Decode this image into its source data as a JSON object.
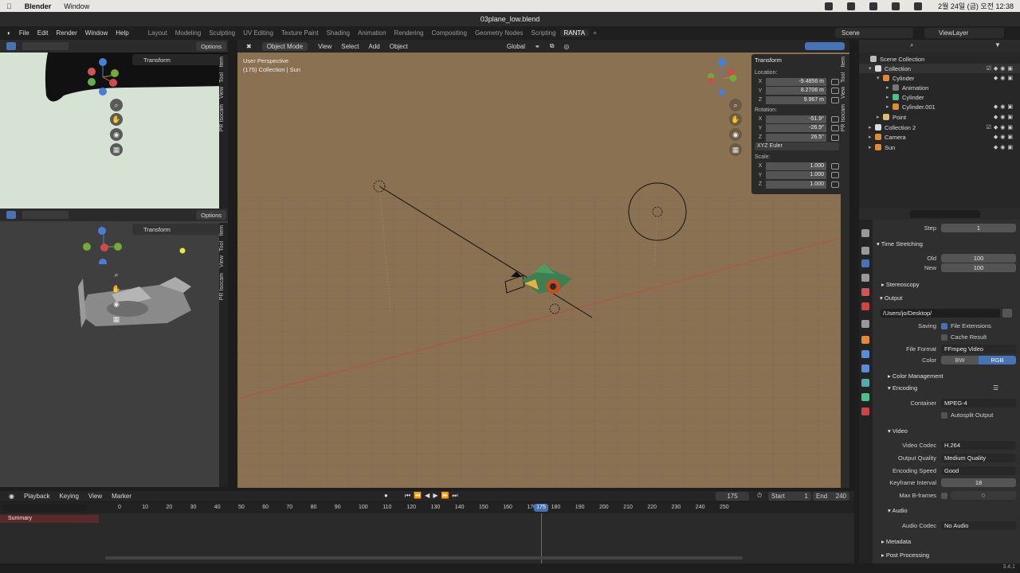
{
  "mac": {
    "app": "Blender",
    "menu": [
      "Window"
    ],
    "clock": "2월 24일 (금) 오전 12:38"
  },
  "window_title": "03plane_low.blend",
  "menus": [
    "File",
    "Edit",
    "Render",
    "Window",
    "Help"
  ],
  "workspaces": [
    "Layout",
    "Modeling",
    "Sculpting",
    "UV Editing",
    "Texture Paint",
    "Shading",
    "Animation",
    "Rendering",
    "Compositing",
    "Geometry Nodes",
    "Scripting",
    "RANTA",
    "+"
  ],
  "scene": "Scene",
  "view_layer": "ViewLayer",
  "left_top": {
    "options": "Options",
    "transform": "Transform",
    "tabs": [
      "Item",
      "Tool",
      "View",
      "PR Isocam"
    ]
  },
  "left_bottom": {
    "options": "Options",
    "transform": "Transform",
    "tabs": [
      "Item",
      "Tool",
      "View",
      "PR Isocam"
    ]
  },
  "viewport": {
    "mode": "Object Mode",
    "menus": [
      "View",
      "Select",
      "Add",
      "Object"
    ],
    "orientation": "Global",
    "info1": "User Perspective",
    "info2": "(175) Collection | Sun",
    "side_tabs": [
      "Item",
      "Tool",
      "View",
      "PR Isocam"
    ]
  },
  "npanel": {
    "title": "Transform",
    "location_label": "Location:",
    "location": {
      "x": "-9.4856 m",
      "y": "8.2706 m",
      "z": "9.967 m"
    },
    "rotation_label": "Rotation:",
    "rotation": {
      "x": "-51.9°",
      "y": "-26.9°",
      "z": "26.5°"
    },
    "euler": "XYZ Euler",
    "scale_label": "Scale:",
    "scale": {
      "x": "1.000",
      "y": "1.000",
      "z": "1.000"
    },
    "axes": [
      "X",
      "Y",
      "Z"
    ]
  },
  "outliner": {
    "items": [
      "Scene Collection",
      "Collection",
      "Cylinder",
      "Animation",
      "Cylinder",
      "Cylinder.001",
      "Point",
      "Collection 2",
      "Camera",
      "Sun"
    ]
  },
  "properties": {
    "step_label": "Step",
    "step": "1",
    "time_stretching": "Time Stretching",
    "old_label": "Old",
    "old": "100",
    "new_label": "New",
    "new": "100",
    "stereoscopy": "Stereoscopy",
    "output": "Output",
    "path": "/Users/jo/Desktop/",
    "saving_label": "Saving",
    "file_extensions": "File Extensions",
    "cache_result": "Cache Result",
    "file_format_label": "File Format",
    "file_format": "FFmpeg Video",
    "color_label": "Color",
    "color_bw": "BW",
    "color_rgb": "RGB",
    "color_management": "Color Management",
    "encoding": "Encoding",
    "container_label": "Container",
    "container": "MPEG-4",
    "autosplit": "Autosplit Output",
    "video": "Video",
    "codec_label": "Video Codec",
    "codec": "H.264",
    "quality_label": "Output Quality",
    "quality": "Medium Quality",
    "speed_label": "Encoding Speed",
    "speed": "Good",
    "keyframe_label": "Keyframe Interval",
    "keyframe": "18",
    "bframes_label": "Max B-frames",
    "bframes": "0",
    "audio": "Audio",
    "audio_codec_label": "Audio Codec",
    "audio_codec": "No Audio",
    "metadata": "Metadata",
    "post_processing": "Post Processing"
  },
  "timeline": {
    "menus": [
      "Playback",
      "Keying",
      "View",
      "Marker"
    ],
    "current_frame": "175",
    "start_label": "Start",
    "start": "1",
    "end_label": "End",
    "end": "240",
    "summary": "Summary",
    "ticks": [
      "0",
      "10",
      "20",
      "30",
      "40",
      "50",
      "60",
      "70",
      "80",
      "90",
      "100",
      "110",
      "120",
      "130",
      "140",
      "150",
      "160",
      "170",
      "180",
      "190",
      "200",
      "210",
      "220",
      "230",
      "240",
      "250"
    ],
    "playhead": "175"
  },
  "status": {
    "version": "3.4.1"
  },
  "colors": {
    "accent": "#4772b3",
    "viewport_bg": "#8a7152",
    "x_axis": "#d04a4a",
    "y_axis": "#78a83a",
    "z_axis": "#4a7ed0"
  }
}
